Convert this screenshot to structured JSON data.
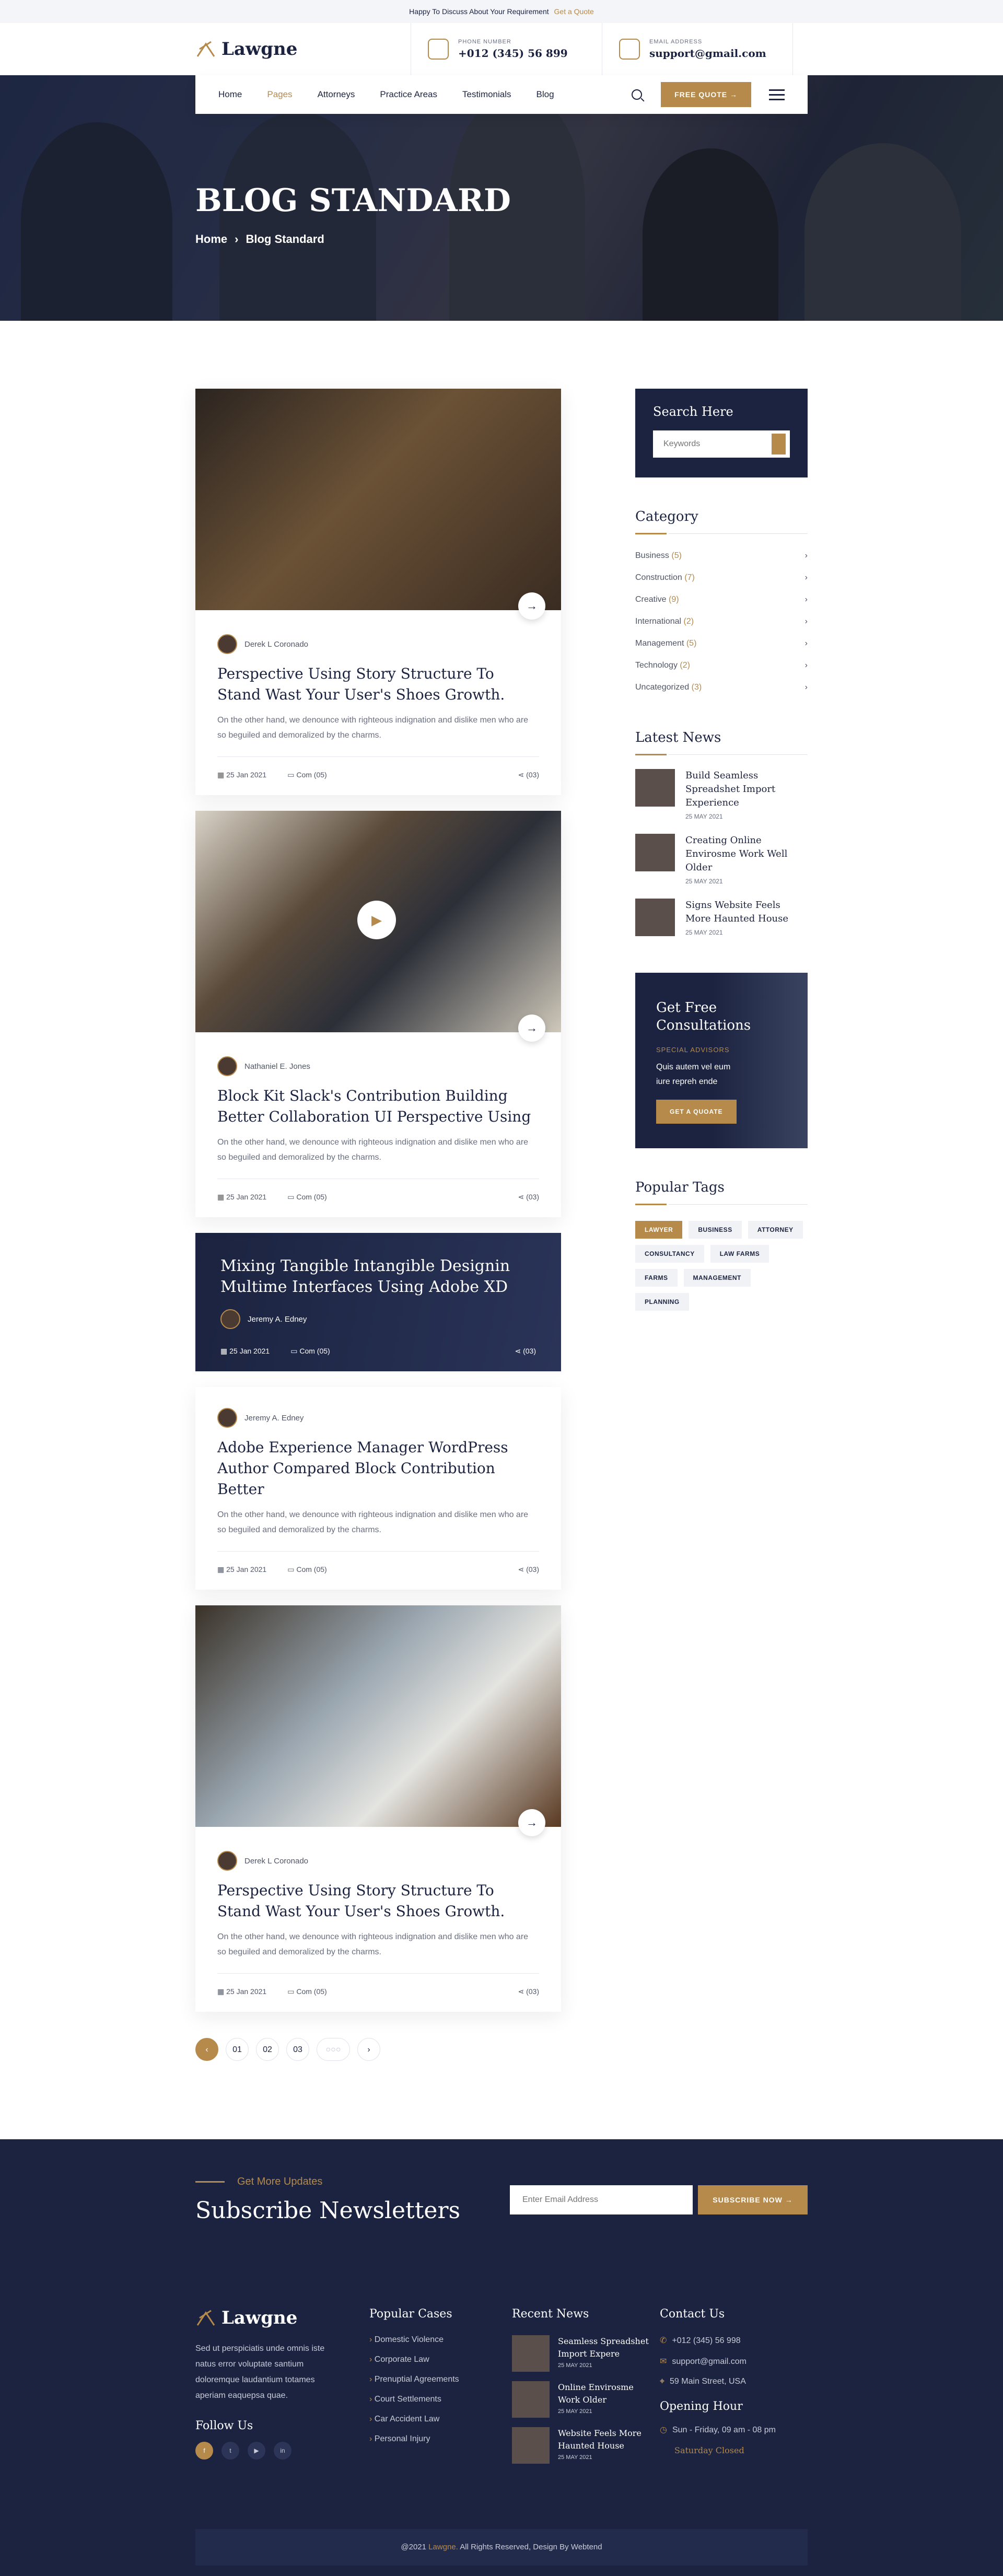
{
  "topbar": {
    "text": "Happy To Discuss About Your Requirement",
    "link": "Get a Quote"
  },
  "brand": {
    "name": "Lawgne",
    "accent": "#b58a4b",
    "navy": "#1b2340"
  },
  "contact": {
    "phone_label": "PHONE NUMBER",
    "phone": "+012 (345) 56 899",
    "email_label": "EMAIL ADDRESS",
    "email": "support@gmail.com"
  },
  "nav": {
    "items": [
      {
        "label": "Home"
      },
      {
        "label": "Pages"
      },
      {
        "label": "Attorneys"
      },
      {
        "label": "Practice Areas"
      },
      {
        "label": "Testimonials"
      },
      {
        "label": "Blog"
      }
    ],
    "cta": "FREE QUOTE"
  },
  "hero": {
    "title": "BLOG STANDARD",
    "crumb_home": "Home",
    "crumb_current": "Blog Standard"
  },
  "posts": [
    {
      "author": "Derek L Coronado",
      "title": "Perspective Using Story Structure To Stand Wast Your User's Shoes Growth.",
      "excerpt": "On the other hand, we denounce with righteous indignation and dislike men who are so beguiled and demoralized by the charms.",
      "date": "25 Jan 2021",
      "comments": "Com (05)",
      "shares": "(03)"
    },
    {
      "author": "Nathaniel E. Jones",
      "title": "Block Kit Slack's Contribution Building Better Collaboration UI Perspective Using",
      "excerpt": "On the other hand, we denounce with righteous indignation and dislike men who are so beguiled and demoralized by the charms.",
      "date": "25 Jan 2021",
      "comments": "Com (05)",
      "shares": "(03)"
    },
    {
      "author": "Jeremy A. Edney",
      "title": "Mixing Tangible Intangible Designin Multime Interfaces Using Adobe XD",
      "date": "25 Jan 2021",
      "comments": "Com (05)",
      "shares": "(03)"
    },
    {
      "author": "Jeremy A. Edney",
      "title": "Adobe Experience Manager WordPress Author Compared Block Contribution Better",
      "excerpt": "On the other hand, we denounce with righteous indignation and dislike men who are so beguiled and demoralized by the charms.",
      "date": "25 Jan 2021",
      "comments": "Com (05)",
      "shares": "(03)"
    },
    {
      "author": "Derek L Coronado",
      "title": "Perspective Using Story Structure To Stand Wast Your User's Shoes Growth.",
      "excerpt": "On the other hand, we denounce with righteous indignation and dislike men who are so beguiled and demoralized by the charms.",
      "date": "25 Jan 2021",
      "comments": "Com (05)",
      "shares": "(03)"
    }
  ],
  "pager": {
    "p1": "01",
    "p2": "02",
    "p3": "03"
  },
  "sidebar": {
    "search_title": "Search Here",
    "search_placeholder": "Keywords",
    "category_title": "Category",
    "categories": [
      {
        "name": "Business",
        "count": "(5)"
      },
      {
        "name": "Construction",
        "count": "(7)"
      },
      {
        "name": "Creative",
        "count": "(9)"
      },
      {
        "name": "International",
        "count": "(2)"
      },
      {
        "name": "Management",
        "count": "(5)"
      },
      {
        "name": "Technology",
        "count": "(2)"
      },
      {
        "name": "Uncategorized",
        "count": "(3)"
      }
    ],
    "news_title": "Latest News",
    "news": [
      {
        "title": "Build Seamless Spreadshet Import Experience",
        "date": "25 MAY 2021"
      },
      {
        "title": "Creating Online Envirosme Work Well Older",
        "date": "25 MAY 2021"
      },
      {
        "title": "Signs Website Feels More Haunted House",
        "date": "25 MAY 2021"
      }
    ],
    "promo": {
      "title": "Get Free Consultations",
      "label": "SPECIAL ADVISORS",
      "text": "Quis autem vel eum iure repreh ende",
      "button": "GET A QUOATE"
    },
    "tags_title": "Popular Tags",
    "tags": [
      "LAWYER",
      "BUSINESS",
      "ATTORNEY",
      "CONSULTANCY",
      "LAW FARMS",
      "FARMS",
      "MANAGEMENT",
      "PLANNING"
    ]
  },
  "footer": {
    "sub_label": "Get More Updates",
    "sub_title": "Subscribe Newsletters",
    "email_placeholder": "Enter Email Address",
    "sub_button": "SUBSCRIBE NOW",
    "about": "Sed ut perspiciatis unde omnis iste natus error voluptate santium doloremque laudantium totames aperiam eaquepsa quae.",
    "follow": "Follow Us",
    "cases_title": "Popular Cases",
    "cases": [
      "Domestic Violence",
      "Corporate Law",
      "Prenuptial Agreements",
      "Court Settlements",
      "Car Accident Law",
      "Personal Injury"
    ],
    "news_title": "Recent News",
    "news": [
      {
        "title": "Seamless Spreadshet Import Expere",
        "date": "25 MAY 2021"
      },
      {
        "title": "Online Envirosme Work Older",
        "date": "25 MAY 2021"
      },
      {
        "title": "Website Feels More Haunted House",
        "date": "25 MAY 2021"
      }
    ],
    "contact_title": "Contact Us",
    "phone": "+012 (345) 56 998",
    "email": "support@gmail.com",
    "address": "59 Main Street, USA",
    "hours_title": "Opening Hour",
    "hours": "Sun - Friday, 09 am - 08 pm",
    "closed": "Saturday Closed",
    "copy_pre": "@2021",
    "copy_brand": "Lawgne.",
    "copy_post": "All Rights Reserved, Design By Webtend"
  }
}
